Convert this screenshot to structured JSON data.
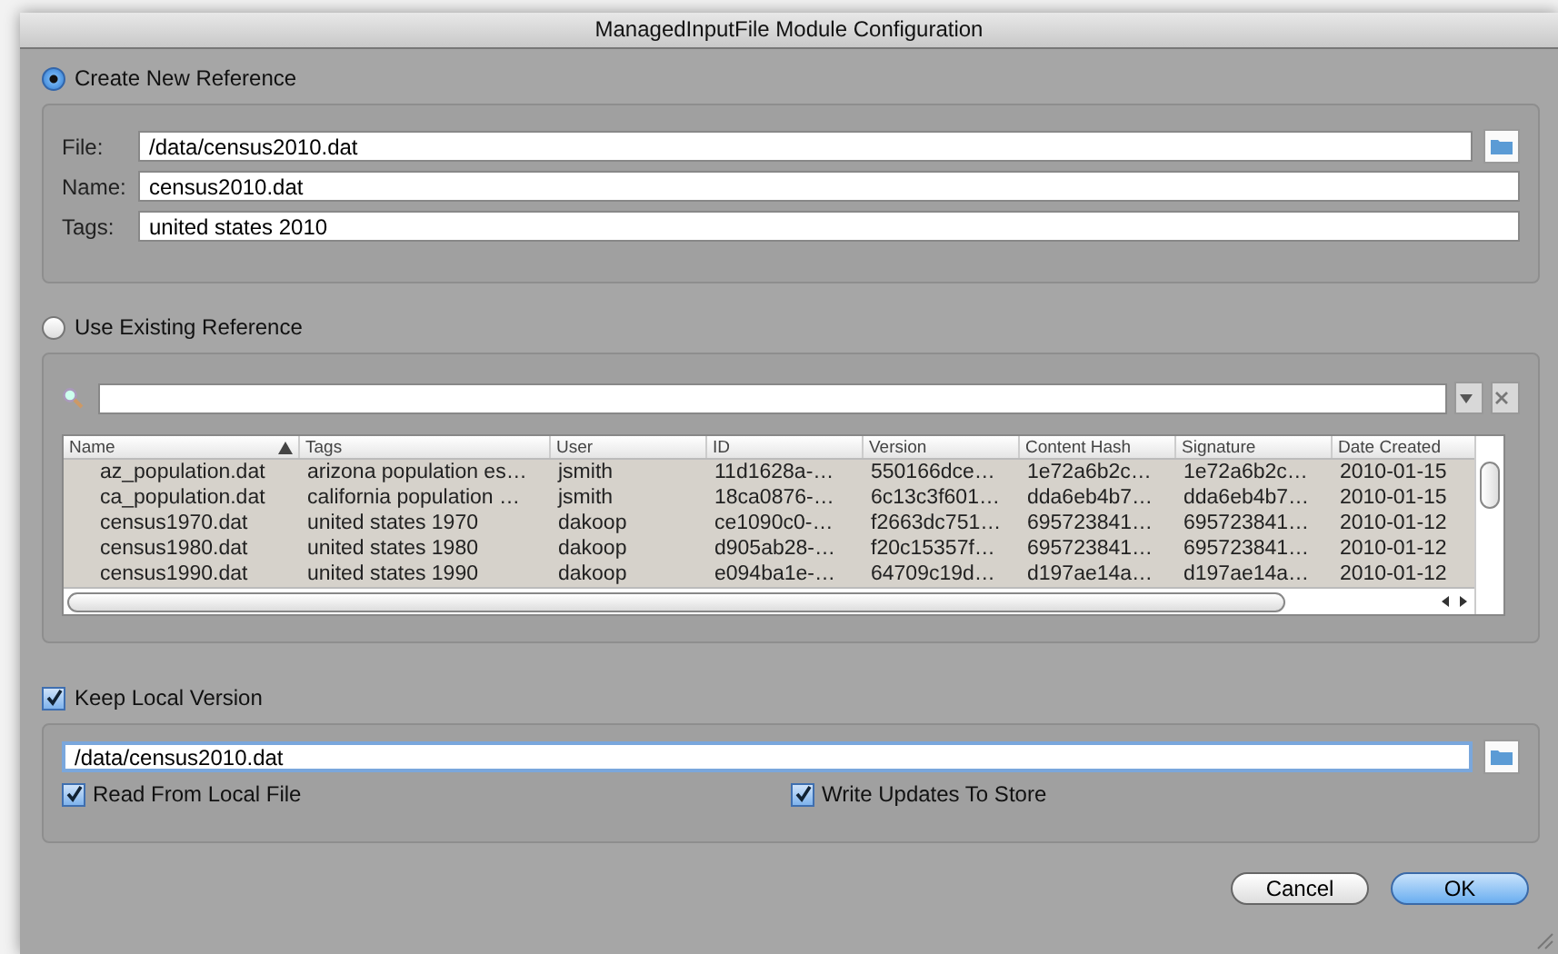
{
  "window": {
    "title": "ManagedInputFile Module Configuration"
  },
  "create_new": {
    "label": "Create New Reference",
    "selected": true,
    "fields": [
      {
        "label": "File:",
        "value": "/data/census2010.dat",
        "browse": true
      },
      {
        "label": "Name:",
        "value": "census2010.dat",
        "browse": false
      },
      {
        "label": "Tags:",
        "value": "united states 2010",
        "browse": false
      }
    ]
  },
  "use_existing": {
    "label": "Use Existing Reference",
    "selected": false,
    "table": {
      "columns": [
        {
          "label": "Name",
          "sorted": true
        },
        {
          "label": "Tags",
          "sorted": false
        },
        {
          "label": "User",
          "sorted": false
        },
        {
          "label": "ID",
          "sorted": false
        },
        {
          "label": "Version",
          "sorted": false
        },
        {
          "label": "Content Hash",
          "sorted": false
        },
        {
          "label": "Signature",
          "sorted": false
        },
        {
          "label": "Date Created",
          "sorted": false
        }
      ],
      "rows": [
        [
          "az_population.dat",
          "arizona population es…",
          "jsmith",
          "11d1628a-…",
          "550166dce…",
          "1e72a6b2c…",
          "1e72a6b2c…",
          "2010-01-15"
        ],
        [
          "ca_population.dat",
          "california population …",
          "jsmith",
          "18ca0876-…",
          "6c13c3f601…",
          "dda6eb4b7…",
          "dda6eb4b7…",
          "2010-01-15"
        ],
        [
          "census1970.dat",
          "united states 1970",
          "dakoop",
          "ce1090c0-…",
          "f2663dc751…",
          "695723841…",
          "695723841…",
          "2010-01-12"
        ],
        [
          "census1980.dat",
          "united states 1980",
          "dakoop",
          "d905ab28-…",
          "f20c15357f…",
          "695723841…",
          "695723841…",
          "2010-01-12"
        ],
        [
          "census1990.dat",
          "united states 1990",
          "dakoop",
          "e094ba1e-…",
          "64709c19d…",
          "d197ae14a…",
          "d197ae14a…",
          "2010-01-12"
        ]
      ]
    }
  },
  "keep_local": {
    "label": "Keep Local Version",
    "checked": true,
    "path": "/data/census2010.dat",
    "options": [
      {
        "label": "Read From Local File",
        "checked": true
      },
      {
        "label": "Write Updates To Store",
        "checked": true
      }
    ]
  },
  "buttons": [
    {
      "label": "Cancel",
      "default": false
    },
    {
      "label": "OK",
      "default": true
    }
  ]
}
